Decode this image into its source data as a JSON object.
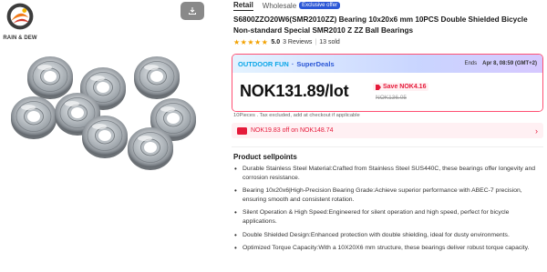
{
  "brand": {
    "name": "RAIN & DEW"
  },
  "tabs": {
    "retail": "Retail",
    "wholesale": "Wholesale",
    "wholesale_badge": "Exclusive offer"
  },
  "product": {
    "title": "S6800ZZO20W6(SMR2010ZZ) Bearing 10x20x6 mm 10PCS Double Shielded Bicycle Non-standard Special SMR2010 Z ZZ Ball Bearings",
    "rating": "5.0",
    "stars": "★★★★★",
    "reviews": "3 Reviews",
    "sold": "13 sold"
  },
  "deal": {
    "brand_label": "OUTDOOR FUN",
    "separator": "·",
    "deal_label": "SuperDeals",
    "ends_label": "Ends",
    "ends_date": "Apr 8, 08:59 (GMT+2)",
    "price": "NOK131.89/lot",
    "save": "Save NOK4.16",
    "original_price": "NOK136.05"
  },
  "tax_note": "10Pieces . Tax excluded, add at checkout if applicable",
  "coupon": {
    "text": "NOK19.83 off on NOK148.74"
  },
  "selling_points": {
    "title": "Product sellpoints",
    "items": [
      "Durable Stainless Steel Material:Crafted from Stainless Steel SUS440C, these bearings offer longevity and corrosion resistance.",
      "Bearing 10x20x6|High-Precision Bearing Grade:Achieve superior performance with ABEC-7 precision, ensuring smooth and consistent rotation.",
      "Silent Operation & High Speed:Engineered for silent operation and high speed, perfect for bicycle applications.",
      "Double Shielded Design:Enhanced protection with double shielding, ideal for dusty environments.",
      "Optimized Torque Capacity:With a 10X20X6 mm structure, these bearings deliver robust torque capacity."
    ]
  },
  "colors": {
    "accent": "#e51a3a",
    "deal_border": "#ff4f72",
    "star": "#f2a100",
    "superdeals": "#2b57d6",
    "outdoor": "#0aa6e8"
  }
}
